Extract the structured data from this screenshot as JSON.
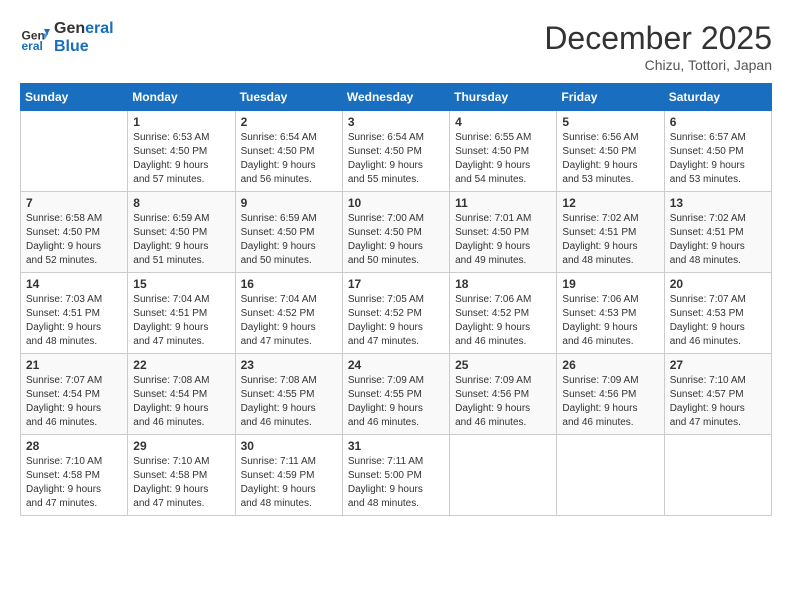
{
  "header": {
    "logo_line1": "General",
    "logo_line2": "Blue",
    "month": "December 2025",
    "location": "Chizu, Tottori, Japan"
  },
  "days_of_week": [
    "Sunday",
    "Monday",
    "Tuesday",
    "Wednesday",
    "Thursday",
    "Friday",
    "Saturday"
  ],
  "weeks": [
    [
      {
        "day": "",
        "info": ""
      },
      {
        "day": "1",
        "info": "Sunrise: 6:53 AM\nSunset: 4:50 PM\nDaylight: 9 hours\nand 57 minutes."
      },
      {
        "day": "2",
        "info": "Sunrise: 6:54 AM\nSunset: 4:50 PM\nDaylight: 9 hours\nand 56 minutes."
      },
      {
        "day": "3",
        "info": "Sunrise: 6:54 AM\nSunset: 4:50 PM\nDaylight: 9 hours\nand 55 minutes."
      },
      {
        "day": "4",
        "info": "Sunrise: 6:55 AM\nSunset: 4:50 PM\nDaylight: 9 hours\nand 54 minutes."
      },
      {
        "day": "5",
        "info": "Sunrise: 6:56 AM\nSunset: 4:50 PM\nDaylight: 9 hours\nand 53 minutes."
      },
      {
        "day": "6",
        "info": "Sunrise: 6:57 AM\nSunset: 4:50 PM\nDaylight: 9 hours\nand 53 minutes."
      }
    ],
    [
      {
        "day": "7",
        "info": "Sunrise: 6:58 AM\nSunset: 4:50 PM\nDaylight: 9 hours\nand 52 minutes."
      },
      {
        "day": "8",
        "info": "Sunrise: 6:59 AM\nSunset: 4:50 PM\nDaylight: 9 hours\nand 51 minutes."
      },
      {
        "day": "9",
        "info": "Sunrise: 6:59 AM\nSunset: 4:50 PM\nDaylight: 9 hours\nand 50 minutes."
      },
      {
        "day": "10",
        "info": "Sunrise: 7:00 AM\nSunset: 4:50 PM\nDaylight: 9 hours\nand 50 minutes."
      },
      {
        "day": "11",
        "info": "Sunrise: 7:01 AM\nSunset: 4:50 PM\nDaylight: 9 hours\nand 49 minutes."
      },
      {
        "day": "12",
        "info": "Sunrise: 7:02 AM\nSunset: 4:51 PM\nDaylight: 9 hours\nand 48 minutes."
      },
      {
        "day": "13",
        "info": "Sunrise: 7:02 AM\nSunset: 4:51 PM\nDaylight: 9 hours\nand 48 minutes."
      }
    ],
    [
      {
        "day": "14",
        "info": "Sunrise: 7:03 AM\nSunset: 4:51 PM\nDaylight: 9 hours\nand 48 minutes."
      },
      {
        "day": "15",
        "info": "Sunrise: 7:04 AM\nSunset: 4:51 PM\nDaylight: 9 hours\nand 47 minutes."
      },
      {
        "day": "16",
        "info": "Sunrise: 7:04 AM\nSunset: 4:52 PM\nDaylight: 9 hours\nand 47 minutes."
      },
      {
        "day": "17",
        "info": "Sunrise: 7:05 AM\nSunset: 4:52 PM\nDaylight: 9 hours\nand 47 minutes."
      },
      {
        "day": "18",
        "info": "Sunrise: 7:06 AM\nSunset: 4:52 PM\nDaylight: 9 hours\nand 46 minutes."
      },
      {
        "day": "19",
        "info": "Sunrise: 7:06 AM\nSunset: 4:53 PM\nDaylight: 9 hours\nand 46 minutes."
      },
      {
        "day": "20",
        "info": "Sunrise: 7:07 AM\nSunset: 4:53 PM\nDaylight: 9 hours\nand 46 minutes."
      }
    ],
    [
      {
        "day": "21",
        "info": "Sunrise: 7:07 AM\nSunset: 4:54 PM\nDaylight: 9 hours\nand 46 minutes."
      },
      {
        "day": "22",
        "info": "Sunrise: 7:08 AM\nSunset: 4:54 PM\nDaylight: 9 hours\nand 46 minutes."
      },
      {
        "day": "23",
        "info": "Sunrise: 7:08 AM\nSunset: 4:55 PM\nDaylight: 9 hours\nand 46 minutes."
      },
      {
        "day": "24",
        "info": "Sunrise: 7:09 AM\nSunset: 4:55 PM\nDaylight: 9 hours\nand 46 minutes."
      },
      {
        "day": "25",
        "info": "Sunrise: 7:09 AM\nSunset: 4:56 PM\nDaylight: 9 hours\nand 46 minutes."
      },
      {
        "day": "26",
        "info": "Sunrise: 7:09 AM\nSunset: 4:56 PM\nDaylight: 9 hours\nand 46 minutes."
      },
      {
        "day": "27",
        "info": "Sunrise: 7:10 AM\nSunset: 4:57 PM\nDaylight: 9 hours\nand 47 minutes."
      }
    ],
    [
      {
        "day": "28",
        "info": "Sunrise: 7:10 AM\nSunset: 4:58 PM\nDaylight: 9 hours\nand 47 minutes."
      },
      {
        "day": "29",
        "info": "Sunrise: 7:10 AM\nSunset: 4:58 PM\nDaylight: 9 hours\nand 47 minutes."
      },
      {
        "day": "30",
        "info": "Sunrise: 7:11 AM\nSunset: 4:59 PM\nDaylight: 9 hours\nand 48 minutes."
      },
      {
        "day": "31",
        "info": "Sunrise: 7:11 AM\nSunset: 5:00 PM\nDaylight: 9 hours\nand 48 minutes."
      },
      {
        "day": "",
        "info": ""
      },
      {
        "day": "",
        "info": ""
      },
      {
        "day": "",
        "info": ""
      }
    ]
  ]
}
